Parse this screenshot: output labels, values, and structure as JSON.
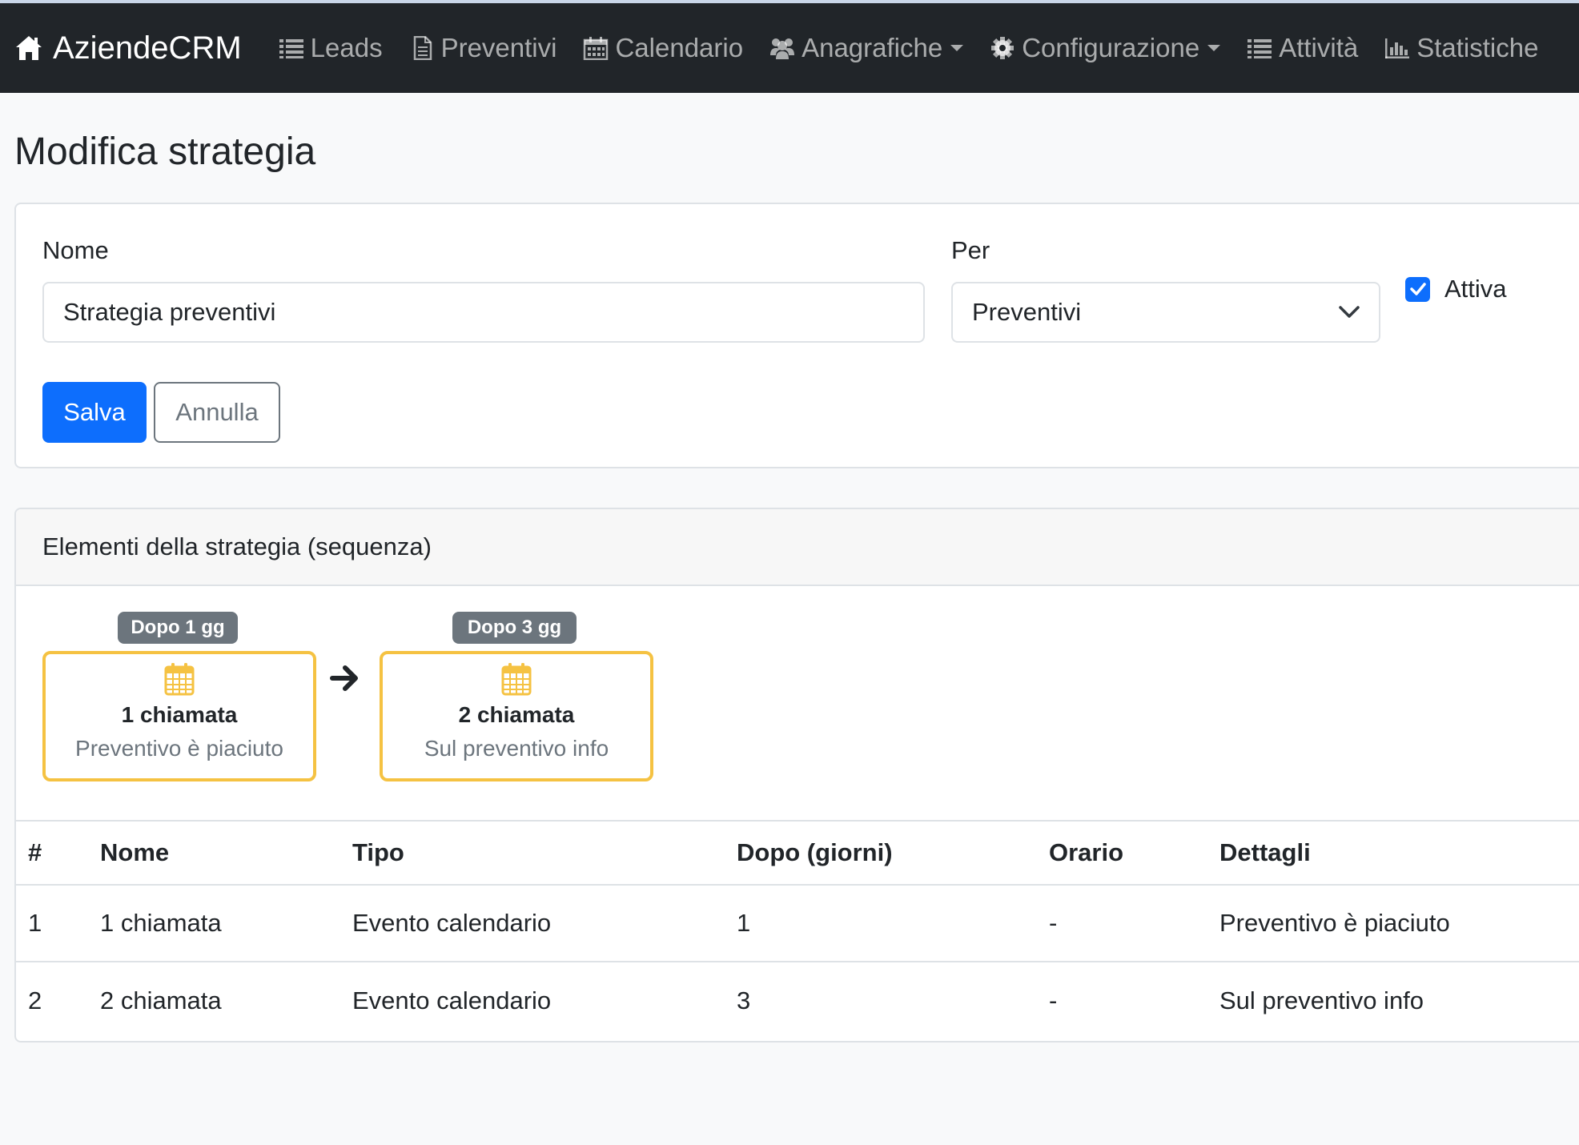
{
  "nav": {
    "brand": "AziendeCRM",
    "items": [
      {
        "label": "Leads",
        "icon": "list-icon"
      },
      {
        "label": "Preventivi",
        "icon": "document-icon"
      },
      {
        "label": "Calendario",
        "icon": "calendar-icon"
      },
      {
        "label": "Anagrafiche",
        "icon": "users-icon",
        "dropdown": true
      },
      {
        "label": "Configurazione",
        "icon": "gear-icon",
        "dropdown": true
      },
      {
        "label": "Attività",
        "icon": "list-icon"
      },
      {
        "label": "Statistiche",
        "icon": "bar-chart-icon"
      }
    ]
  },
  "page": {
    "title": "Modifica strategia"
  },
  "form": {
    "name_label": "Nome",
    "name_value": "Strategia preventivi",
    "per_label": "Per",
    "per_value": "Preventivi",
    "active_label": "Attiva",
    "active_checked": true,
    "save_label": "Salva",
    "cancel_label": "Annulla"
  },
  "sequence": {
    "header": "Elementi della strategia (sequenza)",
    "steps": [
      {
        "badge": "Dopo 1 gg",
        "title": "1 chiamata",
        "desc": "Preventivo è piaciuto"
      },
      {
        "badge": "Dopo 3 gg",
        "title": "2 chiamata",
        "desc": "Sul preventivo info"
      }
    ]
  },
  "table": {
    "headers": [
      "#",
      "Nome",
      "Tipo",
      "Dopo (giorni)",
      "Orario",
      "Dettagli"
    ],
    "rows": [
      [
        "1",
        "1 chiamata",
        "Evento calendario",
        "1",
        "-",
        "Preventivo è piaciuto"
      ],
      [
        "2",
        "2 chiamata",
        "Evento calendario",
        "3",
        "-",
        "Sul preventivo info"
      ]
    ]
  },
  "colors": {
    "navbar": "#212529",
    "primary": "#0d6efd",
    "step_border": "#f5c242",
    "badge": "#6c757d"
  }
}
